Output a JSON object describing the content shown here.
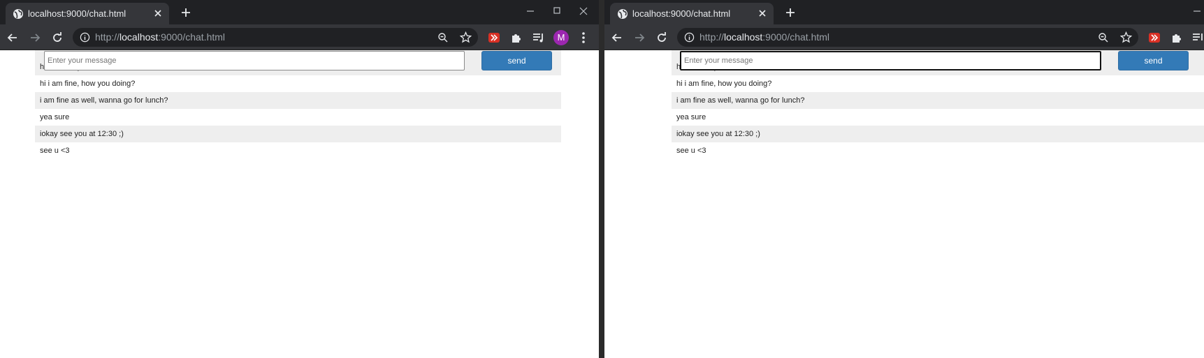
{
  "left_window": {
    "tab_title": "localhost:9000/chat.html",
    "url_scheme": "http://",
    "url_host": "localhost",
    "url_rest": ":9000/chat.html",
    "avatar_letter": "M",
    "placeholder": "Enter your message",
    "send_label": "send",
    "messages": [
      "hi how are you?",
      "hi i am fine, how you doing?",
      "i am fine as well, wanna go for lunch?",
      "yea sure",
      "iokay see you at 12:30 ;)",
      "see u <3"
    ]
  },
  "right_window": {
    "tab_title": "localhost:9000/chat.html",
    "url_scheme": "http://",
    "url_host": "localhost",
    "url_rest": ":9000/chat.html",
    "placeholder": "Enter your message",
    "send_label": "send",
    "messages": [
      "hi how are you?",
      "hi i am fine, how you doing?",
      "i am fine as well, wanna go for lunch?",
      "yea sure",
      "iokay see you at 12:30 ;)",
      "see u <3"
    ]
  },
  "colors": {
    "tabstrip": "#202124",
    "toolbar": "#35363a",
    "send_button": "#337ab7",
    "avatar": "#9c27b0",
    "stripe": "#eeeeee"
  }
}
